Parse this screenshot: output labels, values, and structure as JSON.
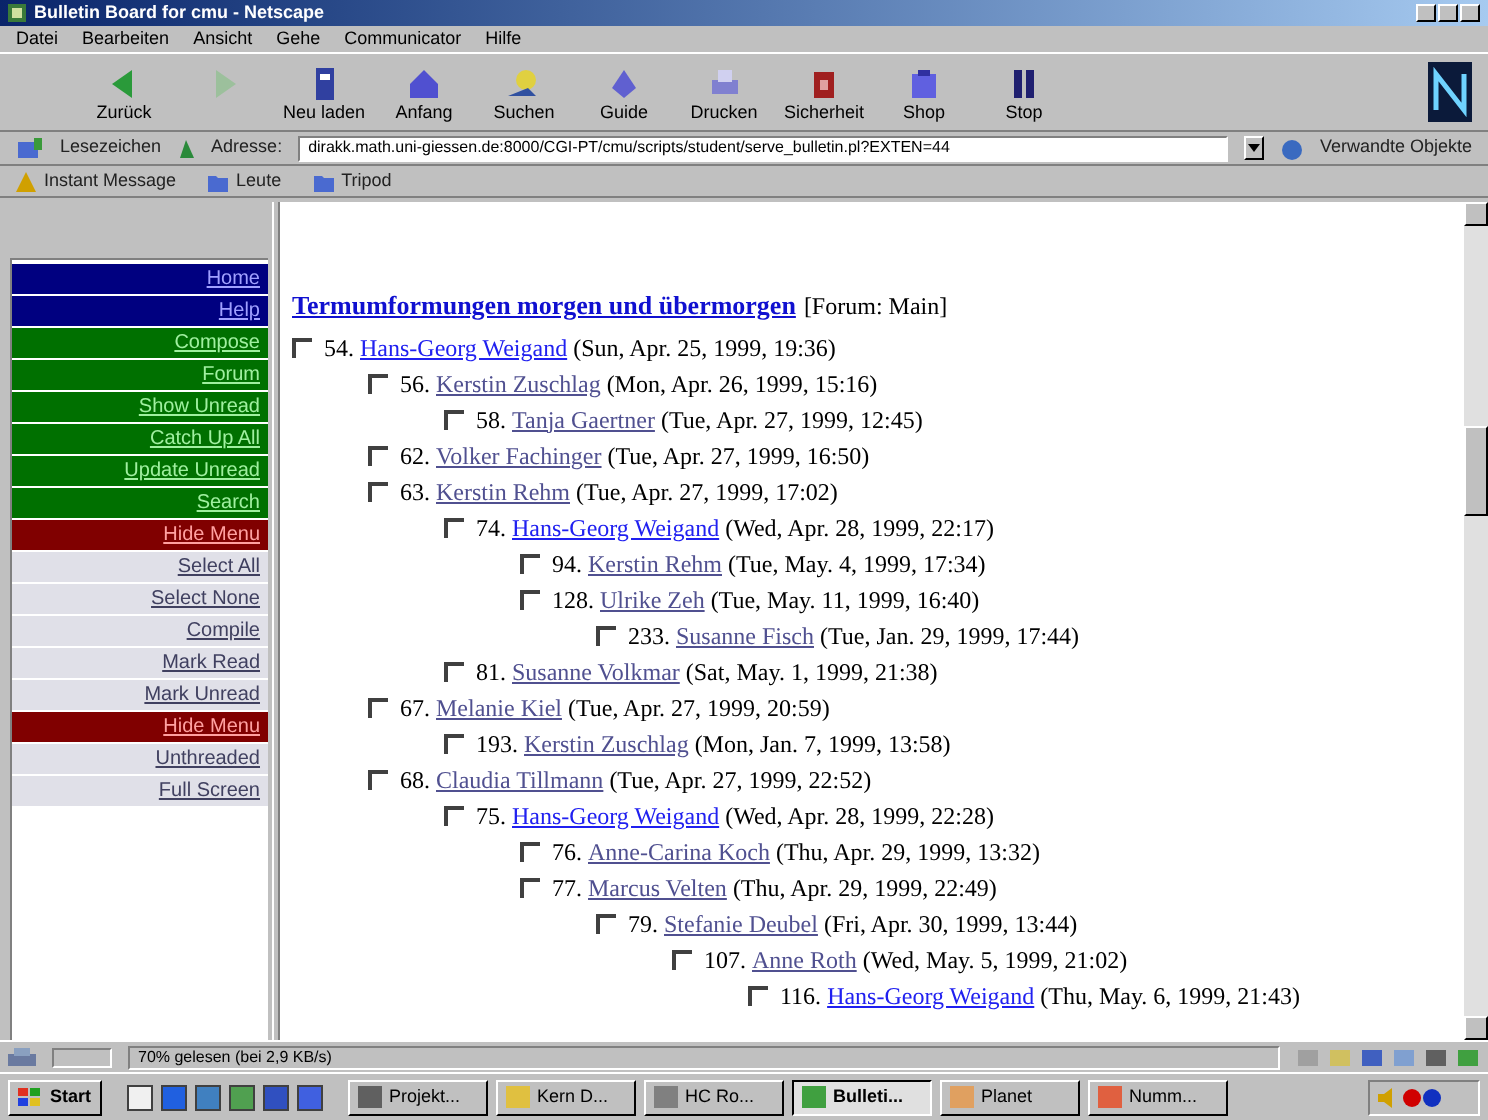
{
  "window": {
    "title": "Bulletin Board for cmu - Netscape"
  },
  "menu": [
    "Datei",
    "Bearbeiten",
    "Ansicht",
    "Gehe",
    "Communicator",
    "Hilfe"
  ],
  "toolbar": [
    {
      "label": "Zurück",
      "disabled": false
    },
    {
      "disabled": true
    },
    {
      "label": "Neu laden",
      "disabled": false
    },
    {
      "label": "Anfang",
      "disabled": false
    },
    {
      "label": "Suchen",
      "disabled": false
    },
    {
      "label": "Guide",
      "disabled": false
    },
    {
      "label": "Drucken",
      "disabled": false
    },
    {
      "label": "Sicherheit",
      "disabled": false
    },
    {
      "label": "Shop",
      "disabled": false
    },
    {
      "label": "Stop",
      "disabled": false
    }
  ],
  "location_bar": {
    "bookmarks": "Lesezeichen",
    "address_label": "Adresse:",
    "url": "dirakk.math.uni-giessen.de:8000/CGI-PT/cmu/scripts/student/serve_bulletin.pl?EXTEN=44",
    "related": "Verwandte Objekte"
  },
  "personal_toolbar": [
    "Instant Message",
    "Leute",
    "Tripod"
  ],
  "sidebar": [
    {
      "label": "Home",
      "kind": "nav"
    },
    {
      "label": "Help",
      "kind": "nav"
    },
    {
      "label": "Compose",
      "kind": "action"
    },
    {
      "label": "Forum",
      "kind": "action"
    },
    {
      "label": "Show Unread",
      "kind": "action"
    },
    {
      "label": "Catch Up All",
      "kind": "action"
    },
    {
      "label": "Update Unread",
      "kind": "action"
    },
    {
      "label": "Search",
      "kind": "action"
    },
    {
      "label": "Hide Menu",
      "kind": "toggle"
    },
    {
      "label": "Select All",
      "kind": "select"
    },
    {
      "label": "Select None",
      "kind": "select"
    },
    {
      "label": "Compile",
      "kind": "select"
    },
    {
      "label": "Mark Read",
      "kind": "select"
    },
    {
      "label": "Mark Unread",
      "kind": "select"
    },
    {
      "label": "Hide Menu",
      "kind": "toggle"
    },
    {
      "label": "Unthreaded",
      "kind": "select"
    },
    {
      "label": "Full Screen",
      "kind": "select"
    }
  ],
  "thread": {
    "title": "Termumformungen morgen und übermorgen",
    "forum": "[Forum: Main]",
    "posts": [
      {
        "number": "54.",
        "author": "Hans-Georg Weigand",
        "date": "(Sun, Apr. 25, 1999, 19:36)",
        "checked": false,
        "visited": false,
        "children": [
          {
            "number": "56.",
            "author": "Kerstin Zuschlag",
            "date": "(Mon, Apr. 26, 1999, 15:16)",
            "checked": false,
            "visited": true,
            "children": [
              {
                "number": "58.",
                "author": "Tanja Gaertner",
                "date": "(Tue, Apr. 27, 1999, 12:45)",
                "checked": false,
                "visited": true
              }
            ]
          },
          {
            "number": "62.",
            "author": "Volker Fachinger",
            "date": "(Tue, Apr. 27, 1999, 16:50)",
            "checked": false,
            "visited": true
          },
          {
            "number": "63.",
            "author": "Kerstin Rehm",
            "date": "(Tue, Apr. 27, 1999, 17:02)",
            "checked": false,
            "visited": true,
            "children": [
              {
                "number": "74.",
                "author": "Hans-Georg Weigand",
                "date": "(Wed, Apr. 28, 1999, 22:17)",
                "checked": false,
                "visited": false,
                "children": [
                  {
                    "number": "94.",
                    "author": "Kerstin Rehm",
                    "date": "(Tue, May. 4, 1999, 17:34)",
                    "checked": false,
                    "visited": true
                  },
                  {
                    "number": "128.",
                    "author": "Ulrike Zeh",
                    "date": "(Tue, May. 11, 1999, 16:40)",
                    "checked": false,
                    "visited": true,
                    "children": [
                      {
                        "number": "233.",
                        "author": "Susanne Fisch",
                        "date": "(Tue, Jan. 29, 1999, 17:44)",
                        "checked": false,
                        "visited": true
                      }
                    ]
                  }
                ]
              },
              {
                "number": "81.",
                "author": "Susanne Volkmar",
                "date": "(Sat, May. 1, 1999, 21:38)",
                "checked": false,
                "visited": true
              }
            ]
          },
          {
            "number": "67.",
            "author": "Melanie Kiel",
            "date": "(Tue, Apr. 27, 1999, 20:59)",
            "checked": false,
            "visited": true,
            "children": [
              {
                "number": "193.",
                "author": "Kerstin Zuschlag",
                "date": "(Mon, Jan. 7, 1999, 13:58)",
                "checked": false,
                "visited": true
              }
            ]
          },
          {
            "number": "68.",
            "author": "Claudia Tillmann",
            "date": "(Tue, Apr. 27, 1999, 22:52)",
            "checked": false,
            "visited": true,
            "children": [
              {
                "number": "75.",
                "author": "Hans-Georg Weigand",
                "date": "(Wed, Apr. 28, 1999, 22:28)",
                "checked": false,
                "visited": false,
                "children": [
                  {
                    "number": "76.",
                    "author": "Anne-Carina Koch",
                    "date": "(Thu, Apr. 29, 1999, 13:32)",
                    "checked": false,
                    "visited": true
                  },
                  {
                    "number": "77.",
                    "author": "Marcus Velten",
                    "date": "(Thu, Apr. 29, 1999, 22:49)",
                    "checked": false,
                    "visited": true,
                    "children": [
                      {
                        "number": "79.",
                        "author": "Stefanie Deubel",
                        "date": "(Fri, Apr. 30, 1999, 13:44)",
                        "checked": false,
                        "visited": true,
                        "children": [
                          {
                            "number": "107.",
                            "author": "Anne Roth",
                            "date": "(Wed, May. 5, 1999, 21:02)",
                            "checked": false,
                            "visited": true,
                            "children": [
                              {
                                "number": "116.",
                                "author": "Hans-Georg Weigand",
                                "date": "(Thu, May. 6, 1999, 21:43)",
                                "checked": false,
                                "visited": false
                              }
                            ]
                          }
                        ]
                      }
                    ]
                  }
                ]
              }
            ]
          }
        ]
      }
    ]
  },
  "status_bar": {
    "text": "70% gelesen (bei 2,9 KB/s)"
  },
  "taskbar": {
    "start": "Start",
    "tasks": [
      {
        "label": "Projekt...",
        "selected": false
      },
      {
        "label": "Kern D...",
        "selected": false
      },
      {
        "label": "HC Ro...",
        "selected": false
      },
      {
        "label": "Bulleti...",
        "selected": true
      },
      {
        "label": "Planet",
        "selected": false
      },
      {
        "label": "Numm...",
        "selected": false
      }
    ]
  }
}
